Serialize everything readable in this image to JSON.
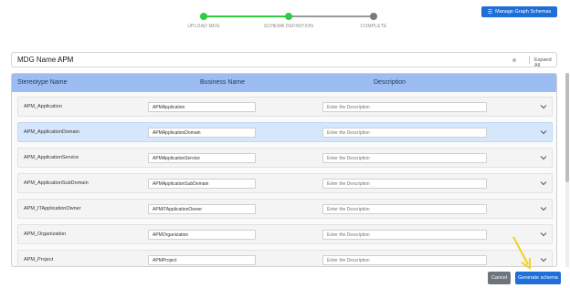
{
  "stepper": {
    "steps": [
      {
        "label": "UPLOAD MDG",
        "state": "complete"
      },
      {
        "label": "SCHEMA DEFINITION",
        "state": "active"
      },
      {
        "label": "COMPLETE",
        "state": "pending"
      }
    ],
    "colors": {
      "done": "#2ecc40",
      "pending": "#888888"
    }
  },
  "header": {
    "manage_label": "Manage Graph Schemas",
    "manage_icon": "list-icon"
  },
  "mdg": {
    "label": "MDG Name :",
    "value": "APM",
    "expand_label": "Expand All"
  },
  "table": {
    "columns": [
      "Stereotype Name",
      "Business Name",
      "Description"
    ],
    "description_placeholder": "Enter the Description",
    "rows": [
      {
        "stereotype": "APM_Application",
        "business": "APMApplication",
        "active": false
      },
      {
        "stereotype": "APM_ApplicationDomain",
        "business": "APMApplicationDomain",
        "active": true
      },
      {
        "stereotype": "APM_ApplicationService",
        "business": "APMApplicationService",
        "active": false
      },
      {
        "stereotype": "APM_ApplicationSubDomain",
        "business": "APMApplicationSubDomain",
        "active": false
      },
      {
        "stereotype": "APM_ITApplicationOwner",
        "business": "APMITApplicationOwner",
        "active": false
      },
      {
        "stereotype": "APM_Organization",
        "business": "APMOrganization",
        "active": false
      },
      {
        "stereotype": "APM_Project",
        "business": "APMProject",
        "active": false
      }
    ]
  },
  "footer": {
    "cancel_label": "Cancel",
    "generate_label": "Generate schema"
  },
  "colors": {
    "accent": "#1e6fd9",
    "header_bg": "#9bbdf2",
    "active_row": "#d6e6fb",
    "annotation_arrow": "#f2d21b"
  }
}
